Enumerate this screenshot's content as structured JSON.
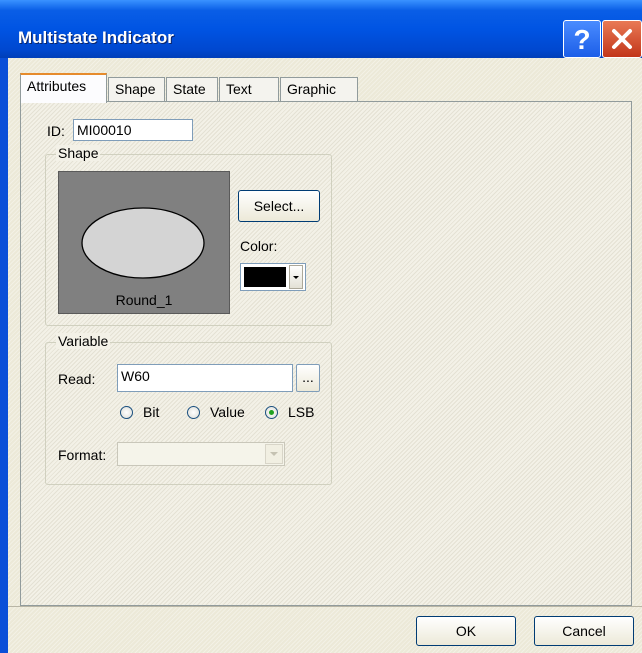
{
  "window": {
    "title": "Multistate Indicator",
    "help_icon": "question-mark-icon",
    "close_icon": "close-x-icon"
  },
  "tabs": [
    {
      "label": "Attributes",
      "active": true
    },
    {
      "label": "Shape",
      "active": false
    },
    {
      "label": "State",
      "active": false
    },
    {
      "label": "Text",
      "active": false
    },
    {
      "label": "Graphic",
      "active": false
    }
  ],
  "attributes": {
    "id_label": "ID:",
    "id_value": "MI00010",
    "shape_group": {
      "title": "Shape",
      "shape_name": "Round_1",
      "select_button": "Select...",
      "color_label": "Color:",
      "color_value": "#000000"
    },
    "variable_group": {
      "title": "Variable",
      "read_label": "Read:",
      "read_value": "W60",
      "browse_button": "...",
      "radio_options": [
        {
          "label": "Bit",
          "selected": false
        },
        {
          "label": "Value",
          "selected": false
        },
        {
          "label": "LSB",
          "selected": true
        }
      ],
      "format_label": "Format:",
      "format_value": ""
    }
  },
  "footer": {
    "ok_button": "OK",
    "cancel_button": "Cancel"
  },
  "colors": {
    "titlebar": "#0054e3",
    "tab_active_accent": "#e68b2c",
    "close_button": "#c2351a",
    "shape_background": "#808080",
    "ellipse_fill": "#d4d4d4"
  }
}
